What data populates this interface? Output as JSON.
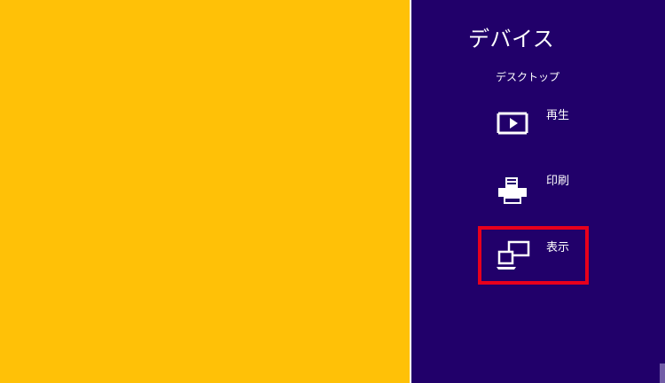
{
  "charms": {
    "title": "デバイス",
    "subtitle": "デスクトップ",
    "items": [
      {
        "label": "再生",
        "icon": "play-to-icon"
      },
      {
        "label": "印刷",
        "icon": "printer-icon"
      },
      {
        "label": "表示",
        "icon": "second-screen-icon"
      }
    ]
  },
  "colors": {
    "desktop_background": "#FFC107",
    "panel_background": "#21006A",
    "highlight": "#E8001C",
    "text": "#FFFFFF"
  }
}
